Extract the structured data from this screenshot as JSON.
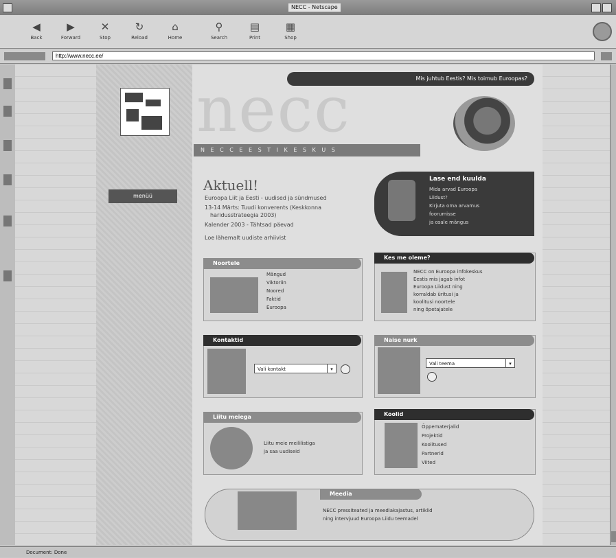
{
  "window": {
    "title": "NECC - Netscape"
  },
  "toolbar": {
    "buttons": [
      {
        "label": "Back",
        "icon": "back-arrow-icon"
      },
      {
        "label": "Forward",
        "icon": "forward-arrow-icon"
      },
      {
        "label": "Stop",
        "icon": "stop-icon"
      },
      {
        "label": "Reload",
        "icon": "reload-icon"
      },
      {
        "label": "Home",
        "icon": "home-icon"
      },
      {
        "label": "Search",
        "icon": "search-icon"
      },
      {
        "label": "Print",
        "icon": "print-icon"
      },
      {
        "label": "Shop",
        "icon": "shop-icon"
      }
    ]
  },
  "location": {
    "url": "http://www.necc.ee/"
  },
  "page": {
    "header_link": "Mis juhtub Eestis? Mis toimub Euroopas?",
    "big_logo_text": "necc",
    "subtitle": "N E C C   E E S T I   K E S K U S",
    "menu_label": "menüü",
    "aktuell_title": "Aktuell!",
    "news": [
      "Euroopa Liit ja Eesti - uudised ja sündmused",
      "13-14 Märts: Tuudi konverents (Keskkonna",
      "haridusstrateegia 2003)",
      "Kalender 2003 - Tähtsad päevad",
      "Loe lähemalt uudiste arhiivist"
    ],
    "dark_box": {
      "title": "Lase end kuulda",
      "lines": [
        "Mida arvad Euroopa",
        "Liidust?",
        "Kirjuta oma arvamus",
        "foorumisse",
        "ja osale mängus"
      ]
    },
    "panels": {
      "noortele": {
        "title": "Noortele",
        "links": [
          "Mängud",
          "Viktoriin",
          "Noored",
          "Faktid",
          "Euroopa"
        ]
      },
      "kes_me_oleme": {
        "title": "Kes me oleme?",
        "text": [
          "NECC on Euroopa infokeskus",
          "Eestis mis jagab infot",
          "Euroopa Liidust ning",
          "korraldab üritusi ja",
          "koolitusi noortele",
          "ning õpetajatele"
        ]
      },
      "kontaktid": {
        "title": "Kontaktid",
        "select": "Vali kontakt"
      },
      "naise_nurk": {
        "title": "Naise nurk",
        "select": "Vali teema"
      },
      "liitu": {
        "title": "Liitu meiega",
        "text": [
          "Liitu meie meililistiga",
          "ja saa uudiseid"
        ]
      },
      "koolid": {
        "title": "Koolid",
        "links": [
          "Õppematerjalid",
          "Projektid",
          "Koolitused",
          "Partnerid",
          "Viited"
        ]
      },
      "meedia": {
        "title": "Meedia",
        "text": [
          "NECC pressiteated ja meediakajastus, artiklid",
          "ning intervjuud Euroopa Liidu teemadel"
        ]
      }
    }
  },
  "statusbar": {
    "text": "Document: Done"
  }
}
